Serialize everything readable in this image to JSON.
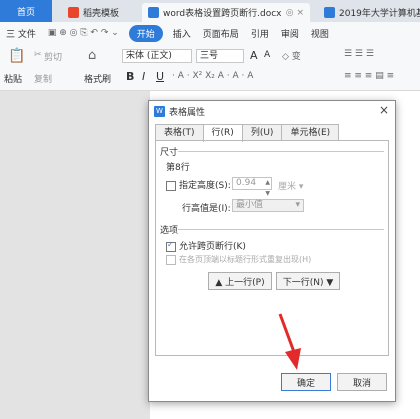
{
  "tabs": [
    {
      "label": "首页"
    },
    {
      "label": "稻壳模板"
    },
    {
      "label": "word表格设置跨页断行.docx"
    },
    {
      "label": "2019年大学计算机基"
    }
  ],
  "menu": {
    "file": "三 文件",
    "items": [
      "开始",
      "插入",
      "页面布局",
      "引用",
      "审阅",
      "视图"
    ]
  },
  "toolbar": {
    "paste": "粘贴",
    "cut": "剪切",
    "copy": "复制",
    "format_painter": "格式刷",
    "font_name": "宋体 (正文)",
    "font_size": "三号",
    "bold": "B",
    "italic": "I",
    "underline": "U",
    "grow": "A",
    "shrink": "A"
  },
  "dialog": {
    "title": "表格属性",
    "close": "×",
    "tabs": [
      {
        "label": "表格(T)",
        "active": false
      },
      {
        "label": "行(R)",
        "active": true
      },
      {
        "label": "列(U)",
        "active": false
      },
      {
        "label": "单元格(E)",
        "active": false
      }
    ],
    "size_section": "尺寸",
    "row_label": "第8行",
    "specify_height": "指定高度(S):",
    "height_value": "0.94",
    "height_unit": "厘米",
    "row_height_label": "行高值是(I):",
    "row_height_value": "最小值",
    "options_section": "选项",
    "allow_break": "允许跨页断行(K)",
    "repeat_header": "在各页顶端以标题行形式重复出现(H)",
    "prev_row": "▲ 上一行(P)",
    "next_row": "下一行(N) ▼",
    "ok": "确定",
    "cancel": "取消"
  }
}
